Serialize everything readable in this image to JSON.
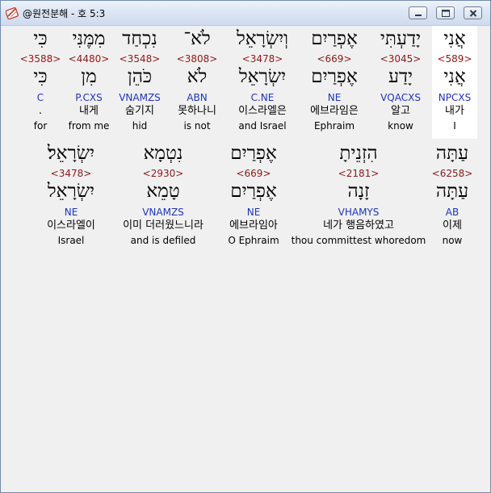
{
  "window": {
    "title": "@원전분해 - 호 5:3",
    "buttons": [
      "minimize",
      "maximize",
      "close"
    ]
  },
  "verse": {
    "rows": [
      [
        {
          "hebrew": "אֲנִי",
          "strong": "<589>",
          "lemma": "אֲנִי",
          "parse": "NPCXS",
          "korean": "내가",
          "english": "I",
          "selected": true
        },
        {
          "hebrew": "יָדַעְתִּי",
          "strong": "<3045>",
          "lemma": "יָדַע",
          "parse": "VQACXS",
          "korean": "알고",
          "english": "know"
        },
        {
          "hebrew": "אֶפְרַיִם",
          "strong": "<669>",
          "lemma": "אֶפְרַיִם",
          "parse": "NE",
          "korean": "에브라임은",
          "english": "Ephraim"
        },
        {
          "hebrew": "וְיִשְׂרָאֵל",
          "strong": "<3478>",
          "lemma": "יִשְׂרָאֵל",
          "parse": "C.NE",
          "korean": "이스라엘은",
          "english": "and Israel"
        },
        {
          "hebrew": "לֹא־",
          "strong": "<3808>",
          "lemma": "לֹא",
          "parse": "ABN",
          "korean": "못하나니",
          "english": "is not"
        },
        {
          "hebrew": "נִכְחַד",
          "strong": "<3548>",
          "lemma": "כֹּהֵן",
          "parse": "VNAMZS",
          "korean": "숨기지",
          "english": "hid"
        },
        {
          "hebrew": "מִמֶּנִּי",
          "strong": "<4480>",
          "lemma": "מִן",
          "parse": "P.CXS",
          "korean": "내게",
          "english": "from me"
        },
        {
          "hebrew": "כִּי",
          "strong": "<3588>",
          "lemma": "כִּי",
          "parse": "C",
          "korean": ".",
          "english": "for"
        }
      ],
      [
        {
          "hebrew": "עַתָּה",
          "strong": "<6258>",
          "lemma": "עַתָּה",
          "parse": "AB",
          "korean": "이제",
          "english": "now"
        },
        {
          "hebrew": "הִזְנֵיתָ",
          "strong": "<2181>",
          "lemma": "זָנָה",
          "parse": "VHAMYS",
          "korean": "네가 행음하였고",
          "english": "thou committest whoredom"
        },
        {
          "hebrew": "אֶפְרַיִם",
          "strong": "<669>",
          "lemma": "אֶפְרַיִם",
          "parse": "NE",
          "korean": "에브라임아",
          "english": "O Ephraim"
        },
        {
          "hebrew": "נִטְמָא",
          "strong": "<2930>",
          "lemma": "טָמֵא",
          "parse": "VNAMZS",
          "korean": "이미 더러웠느니라",
          "english": "and is defiled"
        },
        {
          "hebrew": "יִשְׂרָאֵל׃",
          "strong": "<3478>",
          "lemma": "יִשְׂרָאֵל",
          "parse": "NE",
          "korean": "이스라엘이",
          "english": "Israel"
        }
      ]
    ]
  }
}
